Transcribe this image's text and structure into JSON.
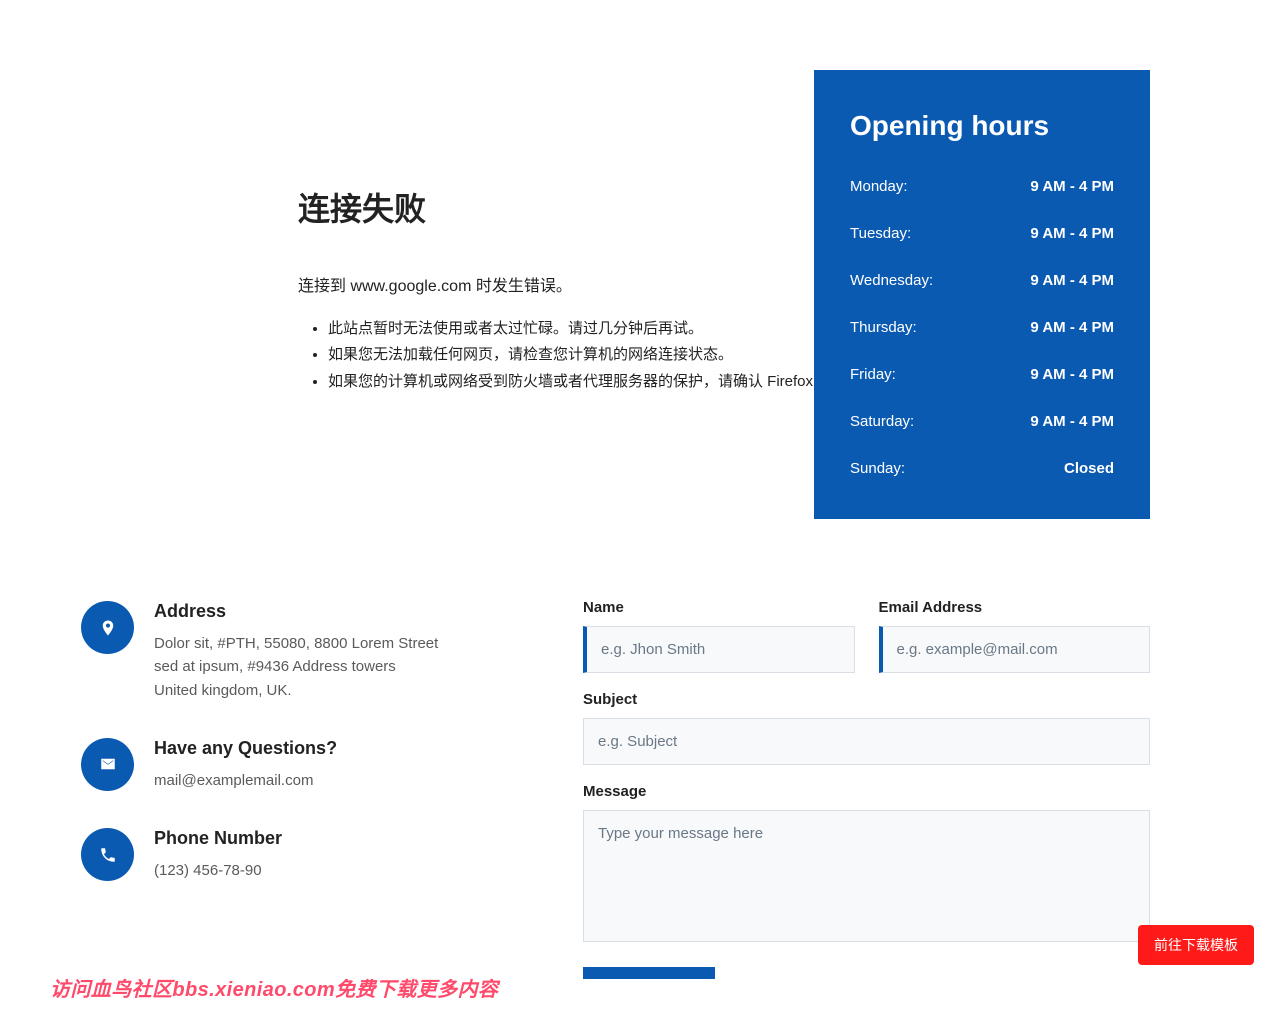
{
  "error": {
    "title": "连接失败",
    "subtitle": "连接到 www.google.com 时发生错误。",
    "items": [
      "此站点暂时无法使用或者太过忙碌。请过几分钟后再试。",
      "如果您无法加载任何网页，请检查您计算机的网络连接状态。",
      "如果您的计算机或网络受到防火墙或者代理服务器的保护，请确认 Firefox 已"
    ]
  },
  "hours": {
    "title": "Opening hours",
    "rows": [
      {
        "day": "Monday:",
        "time": "9 AM - 4 PM"
      },
      {
        "day": "Tuesday:",
        "time": "9 AM - 4 PM"
      },
      {
        "day": "Wednesday:",
        "time": "9 AM - 4 PM"
      },
      {
        "day": "Thursday:",
        "time": "9 AM - 4 PM"
      },
      {
        "day": "Friday:",
        "time": "9 AM - 4 PM"
      },
      {
        "day": "Saturday:",
        "time": "9 AM - 4 PM"
      },
      {
        "day": "Sunday:",
        "time": "Closed"
      }
    ]
  },
  "contact": {
    "address": {
      "heading": "Address",
      "line1": "Dolor sit, #PTH, 55080, 8800 Lorem Street",
      "line2": "sed at ipsum, #9436 Address towers",
      "line3": "United kingdom, UK."
    },
    "questions": {
      "heading": "Have any Questions?",
      "value": "mail@examplemail.com"
    },
    "phone": {
      "heading": "Phone Number",
      "value": "(123) 456-78-90"
    }
  },
  "form": {
    "name_label": "Name",
    "name_placeholder": "e.g. Jhon Smith",
    "email_label": "Email Address",
    "email_placeholder": "e.g. example@mail.com",
    "subject_label": "Subject",
    "subject_placeholder": "e.g. Subject",
    "message_label": "Message",
    "message_placeholder": "Type your message here"
  },
  "watermark": "访问血鸟社区bbs.xieniao.com免费下载更多内容",
  "download_label": "前往下载模板"
}
